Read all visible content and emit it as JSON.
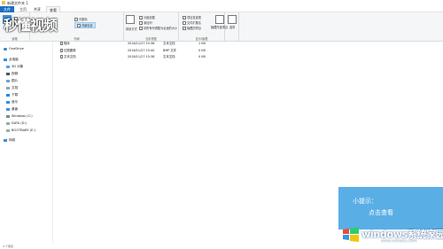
{
  "window": {
    "title": "新建文件夹 1"
  },
  "tabs": [
    "文件",
    "主页",
    "共享",
    "查看"
  ],
  "ribbon": {
    "groups": [
      {
        "label": "窗格"
      },
      {
        "label": "布局"
      },
      {
        "label": "当前视图"
      },
      {
        "label": "显示/隐藏"
      },
      {
        "label": ""
      }
    ],
    "layout_items": [
      "中图标",
      "详细信息"
    ],
    "sort_label": "排序方式",
    "view_items": [
      "分组依据",
      "添加列",
      "将所有列调整为合适的大小"
    ],
    "showhide_items": [
      "项目复选框",
      "文件扩展名",
      "隐藏的项目"
    ],
    "hide_selected": "隐藏所选项目",
    "options": "选项"
  },
  "nav": [
    {
      "label": "OneDrive",
      "icon": "cloud-icon"
    },
    {
      "label": "此电脑",
      "icon": "computer-icon"
    },
    {
      "label": "3D 对象",
      "icon": "cube-icon"
    },
    {
      "label": "视频",
      "icon": "video-icon"
    },
    {
      "label": "图片",
      "icon": "picture-icon"
    },
    {
      "label": "文档",
      "icon": "document-icon"
    },
    {
      "label": "下载",
      "icon": "download-icon"
    },
    {
      "label": "音乐",
      "icon": "music-icon"
    },
    {
      "label": "桌面",
      "icon": "desktop-icon"
    },
    {
      "label": "Windows (C:)",
      "icon": "drive-icon"
    },
    {
      "label": "DATA (D:)",
      "icon": "drive-icon"
    },
    {
      "label": "BOOTBABY (E:)",
      "icon": "drive-icon"
    },
    {
      "label": "网络",
      "icon": "network-icon"
    }
  ],
  "files": [
    {
      "name": "程序",
      "date": "2018/11/27 15:38",
      "type": "文本文档",
      "size": "1 KB"
    },
    {
      "name": "位图图像",
      "date": "2018/11/27 15:40",
      "type": "BMP 文件",
      "size": "0 KB"
    },
    {
      "name": "文本文档",
      "date": "2018/11/27 15:38",
      "type": "文本文档",
      "size": "0 KB"
    }
  ],
  "status": "3 个项目",
  "watermark": {
    "text": "秒懂视频"
  },
  "hint": {
    "line1": "小提示：",
    "line2": "点击查看"
  },
  "brand": {
    "title": "windows系统家园",
    "url": "www.ruihaitu.com"
  },
  "colors": {
    "accent": "#1a6fc4",
    "hint_bg": "#5aaee6"
  }
}
